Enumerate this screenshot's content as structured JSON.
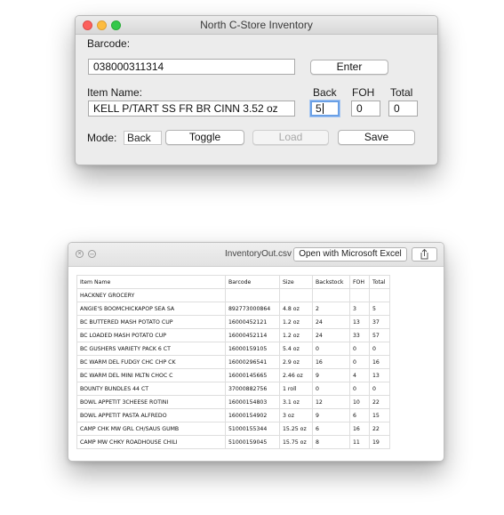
{
  "app": {
    "title": "North C-Store Inventory",
    "barcode_label": "Barcode:",
    "barcode_value": "038000311314",
    "enter_label": "Enter",
    "item_name_label": "Item Name:",
    "item_name_value": "KELL P/TART SS FR BR CINN 3.52 oz",
    "back_label": "Back",
    "back_value": "5",
    "foh_label": "FOH",
    "foh_value": "0",
    "total_label": "Total",
    "total_value": "0",
    "mode_label": "Mode:",
    "mode_value": "Back",
    "toggle_label": "Toggle",
    "load_label": "Load",
    "save_label": "Save"
  },
  "preview": {
    "filename": "InventoryOut.csv",
    "open_label": "Open with Microsoft Excel",
    "columns": [
      "Item Name",
      "Barcode",
      "Size",
      "Backstock",
      "FOH",
      "Total"
    ],
    "rows": [
      [
        "HACKNEY GROCERY",
        "",
        "",
        "",
        "",
        ""
      ],
      [
        "ANGIE'S BOOMCHICKAPOP SEA SA",
        "892773000864",
        "4.8 oz",
        "2",
        "3",
        "5"
      ],
      [
        "BC BUTTERED MASH POTATO CUP",
        "16000452121",
        "1.2 oz",
        "24",
        "13",
        "37"
      ],
      [
        "BC LOADED MASH POTATO CUP",
        "16000452114",
        "1.2 oz",
        "24",
        "33",
        "57"
      ],
      [
        "BC GUSHERS VARIETY PACK 6 CT",
        "16000159105",
        "5.4 oz",
        "0",
        "0",
        "0"
      ],
      [
        "BC WARM DEL FUDGY CHC CHP CK",
        "16000296541",
        "2.9 oz",
        "16",
        "0",
        "16"
      ],
      [
        "BC WARM DEL MINI MLTN CHOC C",
        "16000145665",
        "2.46 oz",
        "9",
        "4",
        "13"
      ],
      [
        "BOUNTY BUNDLES 44 CT",
        "37000882756",
        "1 roll",
        "0",
        "0",
        "0"
      ],
      [
        "BOWL APPETIT 3CHEESE ROTINI",
        "16000154803",
        "3.1 oz",
        "12",
        "10",
        "22"
      ],
      [
        "BOWL APPETIT PASTA ALFREDO",
        "16000154902",
        "3 oz",
        "9",
        "6",
        "15"
      ],
      [
        "CAMP CHK MW GRL CH/SAUS GUMB",
        "51000155344",
        "15.25 oz",
        "6",
        "16",
        "22"
      ],
      [
        "CAMP MW CHKY ROADHOUSE CHILI",
        "51000159045",
        "15.75 oz",
        "8",
        "11",
        "19"
      ]
    ]
  }
}
